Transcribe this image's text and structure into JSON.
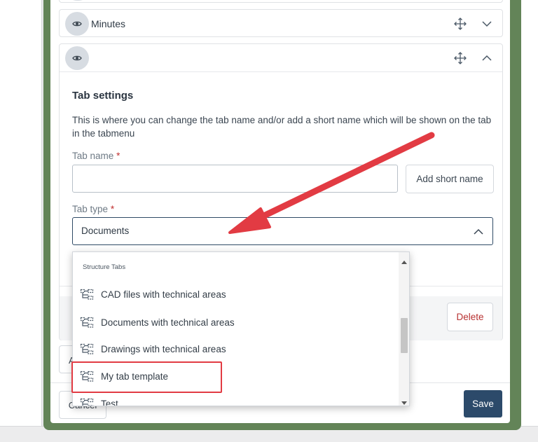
{
  "tabs": [
    {
      "title": ""
    },
    {
      "title": "Minutes"
    },
    {
      "title": ""
    }
  ],
  "settings": {
    "title": "Tab settings",
    "description": "This is where you can change the tab name and/or add a short name which will be shown on the tab in the tabmenu",
    "tab_name_label": "Tab name",
    "tab_name_value": "",
    "required_mark": "*",
    "add_short_name_label": "Add short name",
    "tab_type_label": "Tab type",
    "tab_type_value": "Documents"
  },
  "dropdown": {
    "group_label": "Structure Tabs",
    "items": [
      {
        "label": "CAD files with technical areas"
      },
      {
        "label": "Documents with technical areas"
      },
      {
        "label": "Drawings with technical areas"
      },
      {
        "label": "My tab template",
        "highlighted": true
      },
      {
        "label": "Test"
      }
    ]
  },
  "buttons": {
    "delete_label": "Delete",
    "add_partial_label": "A",
    "cancel_label": "Cancel",
    "save_label": "Save"
  },
  "colors": {
    "frame_green": "#638458",
    "save_blue": "#2c4a6a",
    "delete_red": "#b83232",
    "annotation_red": "#e23b43",
    "eye_bg": "#d7dce2"
  },
  "icons": {
    "visibility": "eye-icon",
    "move": "move-arrows-icon",
    "expand": "chevron-down-icon",
    "collapse": "chevron-up-icon",
    "structure": "structure-tab-icon"
  }
}
